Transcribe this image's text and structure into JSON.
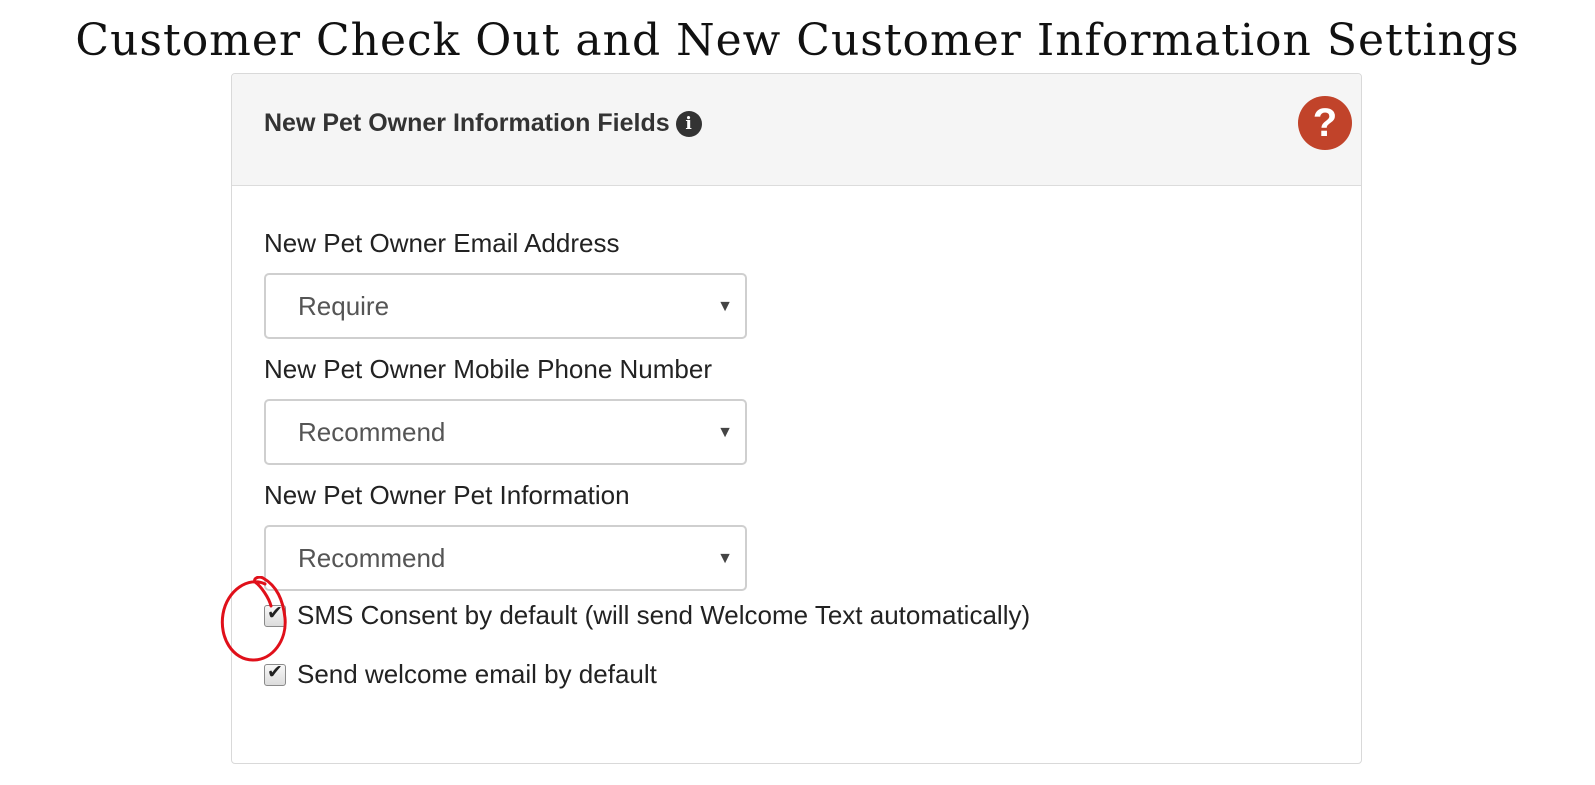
{
  "page": {
    "title": "Customer Check Out and New Customer Information Settings"
  },
  "panel": {
    "heading": "New Pet Owner Information Fields",
    "info_icon": "info-circle-icon",
    "help_icon": "question-circle-icon",
    "help_glyph": "?",
    "accent_color": "#c1432a"
  },
  "fields": [
    {
      "label": "New Pet Owner Email Address",
      "selected": "Require"
    },
    {
      "label": "New Pet Owner Mobile Phone Number",
      "selected": "Recommend"
    },
    {
      "label": "New Pet Owner Pet Information",
      "selected": "Recommend"
    }
  ],
  "checkboxes": [
    {
      "label": "SMS Consent by default (will send Welcome Text automatically)",
      "checked": true
    },
    {
      "label": "Send welcome email by default",
      "checked": true
    }
  ],
  "annotation": {
    "color": "#e0101a",
    "shape": "hand-drawn circle around SMS consent checkbox"
  }
}
